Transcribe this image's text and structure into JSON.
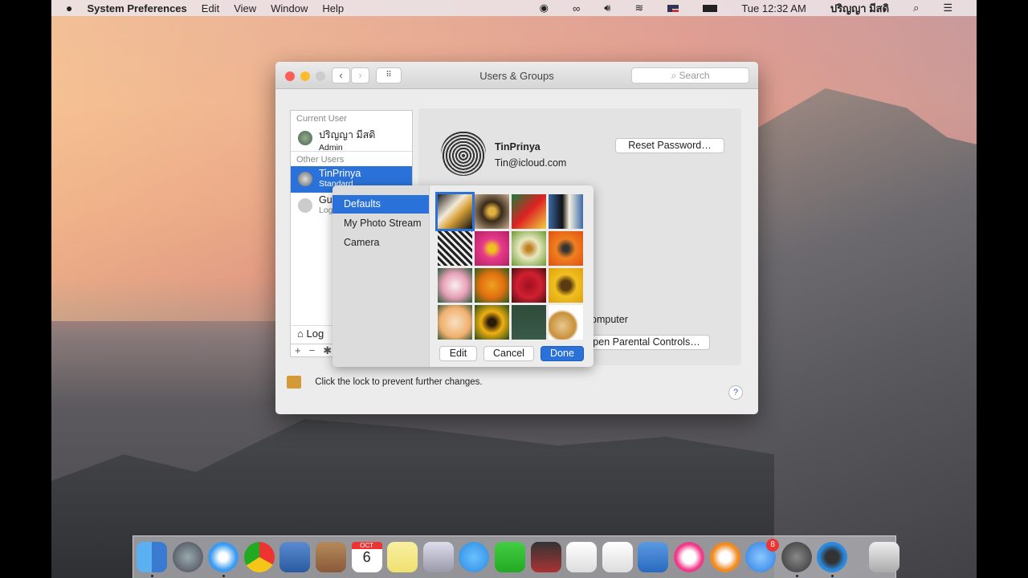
{
  "menubar": {
    "app": "System Preferences",
    "menus": [
      "Edit",
      "View",
      "Window",
      "Help"
    ],
    "clock": "Tue 12:32 AM",
    "user": "ปริญญา มีสดิ"
  },
  "window": {
    "title": "Users & Groups",
    "search_placeholder": "Search"
  },
  "users": {
    "current_header": "Current User",
    "current": {
      "name": "ปริญญา มีสดิ",
      "role": "Admin"
    },
    "other_header": "Other Users",
    "others": [
      {
        "name": "TinPrinya",
        "role": "Standard"
      },
      {
        "name": "Gu",
        "role": "Log"
      }
    ],
    "login_options": "Log"
  },
  "detail": {
    "name": "TinPrinya",
    "email": "Tin@icloud.com",
    "reset_password": "Reset Password…",
    "computer_text": "omputer",
    "parental_controls": "pen Parental Controls…"
  },
  "picker": {
    "sources": [
      "Defaults",
      "My Photo Stream",
      "Camera"
    ],
    "selected_source": "Defaults",
    "tiles": [
      "eagle",
      "owl",
      "parrot",
      "penguin",
      "zebra",
      "pink-flower",
      "dandelion",
      "orange-daisy",
      "lotus",
      "poppy",
      "red-rose",
      "sunflower",
      "peach-rose",
      "black-eyed-susan",
      "chalkboard",
      "fortune-cookie"
    ],
    "selected_tile": "eagle",
    "edit": "Edit",
    "cancel": "Cancel",
    "done": "Done"
  },
  "lock": {
    "text": "Click the lock to prevent further changes."
  },
  "dock": {
    "calendar_month": "OCT",
    "calendar_day": "6",
    "appstore_badge": "8",
    "apps": [
      "finder",
      "launchpad",
      "safari",
      "chrome",
      "mail",
      "contacts",
      "calendar",
      "notes",
      "preview",
      "messages",
      "facetime",
      "photo-booth",
      "textedit",
      "numbers",
      "keynote",
      "itunes",
      "ibooks",
      "app-store",
      "system-preferences",
      "quicktime",
      "trash"
    ]
  }
}
